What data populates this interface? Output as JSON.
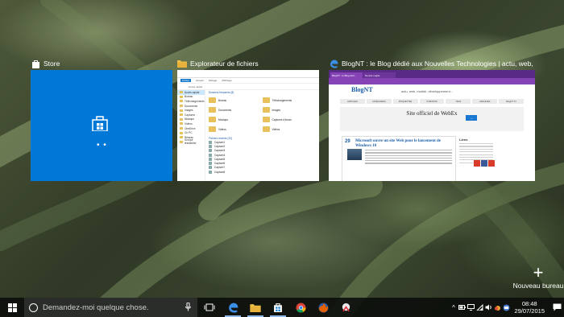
{
  "windows": {
    "store": {
      "title": "Store"
    },
    "explorer": {
      "title": "Explorateur de fichiers",
      "ribbon": [
        "Fichier",
        "Accueil",
        "Partage",
        "Affichage"
      ],
      "address": "Accès rapide",
      "nav": [
        "Accès rapide",
        "Bureau",
        "Téléchargements",
        "Documents",
        "Images",
        "Captures",
        "Musique",
        "Vidéos",
        "OneDrive",
        "Ce PC",
        "Réseau",
        "Groupe résidentiel"
      ],
      "frequent_header": "Dossiers fréquents (8)",
      "folders": [
        "Bureau",
        "Téléchargements",
        "Documents",
        "Images",
        "Musique",
        "Captures d'écran",
        "Vidéos",
        "Vidéos"
      ],
      "recent_header": "Fichiers récents (20)",
      "recent": [
        "Capture1",
        "Capture2",
        "Capture3",
        "Capture4",
        "Capture5",
        "Capture6",
        "Capture7",
        "Capture8"
      ]
    },
    "edge": {
      "title": "BlogNT : le Blog dédié aux Nouvelles Technologies | actu, web, mobile, déve...",
      "tabs": [
        "BlogNT : le Blog déd...",
        "Nouvel onglet"
      ],
      "logo": "BlogNT",
      "tagline": "actu, web, mobile, développement...",
      "nav": [
        "ARTICLES",
        "CATÉGORIES",
        "ÉTIQUETTES",
        "À PROPOS",
        "TAGS",
        "ARCHIVES",
        "BlogNT TV"
      ],
      "promo_title": "Site officiel de WebEx",
      "article_date": "29",
      "article_title": "Microsoft ouvre un site Web pour le lancement de Windows 10",
      "sidebar_header": "Liens"
    }
  },
  "new_desktop": {
    "label": "Nouveau bureau"
  },
  "taskbar": {
    "search_placeholder": "Demandez-moi quelque chose.",
    "time": "08:48",
    "date": "29/07/2015"
  },
  "colors": {
    "store_blue": "#0078d7",
    "edge_purple": "#8643b5",
    "taskbar": "#0a0c0a"
  }
}
